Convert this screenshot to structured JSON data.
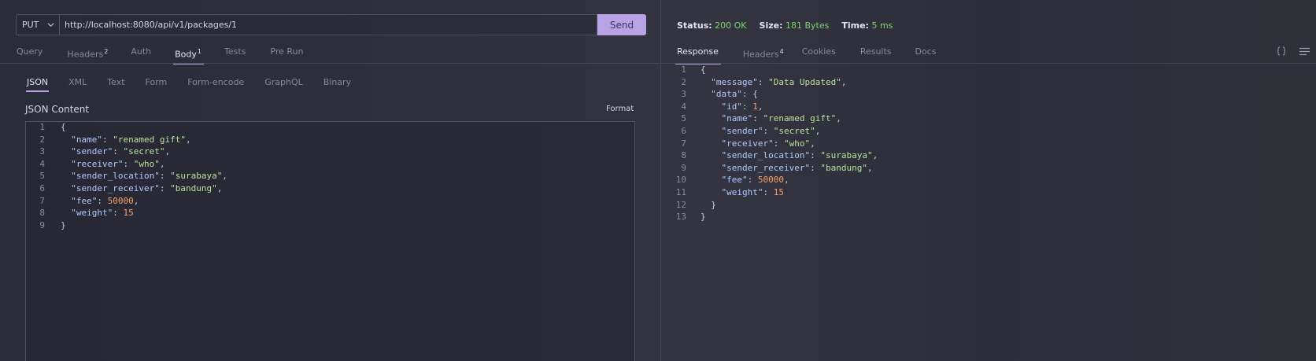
{
  "request": {
    "method": "PUT",
    "url": "http://localhost:8080/api/v1/packages/1",
    "send_label": "Send",
    "tabs": [
      {
        "label": "Query",
        "badge": ""
      },
      {
        "label": "Headers",
        "badge": "2"
      },
      {
        "label": "Auth",
        "badge": ""
      },
      {
        "label": "Body",
        "badge": "1"
      },
      {
        "label": "Tests",
        "badge": ""
      },
      {
        "label": "Pre Run",
        "badge": ""
      }
    ],
    "active_tab": "Body",
    "body_tabs": [
      "JSON",
      "XML",
      "Text",
      "Form",
      "Form-encode",
      "GraphQL",
      "Binary"
    ],
    "active_body_tab": "JSON",
    "content_title": "JSON Content",
    "format_label": "Format",
    "line_numbers": [
      "1",
      "2",
      "3",
      "4",
      "5",
      "6",
      "7",
      "8",
      "9"
    ]
  },
  "response": {
    "status_label": "Status:",
    "status_value": "200 OK",
    "size_label": "Size:",
    "size_value": "181 Bytes",
    "time_label": "Time:",
    "time_value": "5 ms",
    "tabs": [
      {
        "label": "Response",
        "badge": ""
      },
      {
        "label": "Headers",
        "badge": "4"
      },
      {
        "label": "Cookies",
        "badge": ""
      },
      {
        "label": "Results",
        "badge": ""
      },
      {
        "label": "Docs",
        "badge": ""
      }
    ],
    "active_tab": "Response",
    "line_numbers": [
      "1",
      "2",
      "3",
      "4",
      "5",
      "6",
      "7",
      "8",
      "9",
      "10",
      "11",
      "12",
      "13"
    ]
  },
  "icons": {
    "method_dropdown": "chevron-down-icon",
    "braces": "braces-icon",
    "menu": "menu-icon"
  },
  "colors": {
    "accent": "#b9a2e6",
    "status_ok": "#7fd16e",
    "json_key": "#aecbff",
    "json_string": "#b8e39d",
    "json_number": "#f4a26f"
  }
}
